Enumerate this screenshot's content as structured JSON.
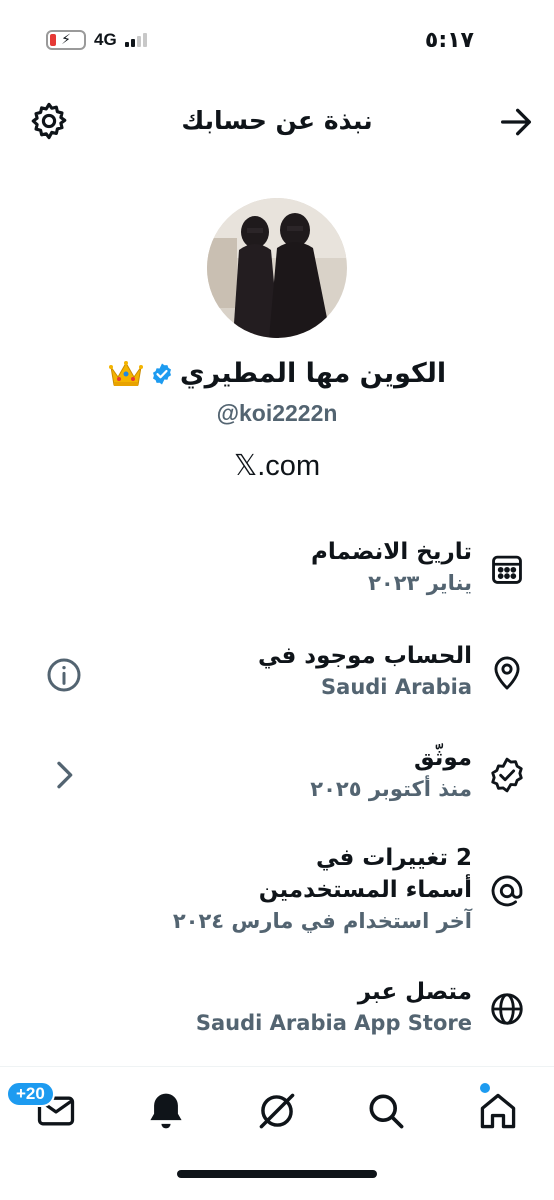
{
  "status_bar": {
    "time": "٥:١٧",
    "network": "4G"
  },
  "header": {
    "title": "نبذة عن حسابك"
  },
  "profile": {
    "name": "الكوين مها المطيري",
    "handle": "@koi2222n",
    "website": "𝕏.com"
  },
  "info": [
    {
      "icon": "calendar-icon",
      "title": "تاريخ الانضمام",
      "sub": "يناير ٢٠٢٣"
    },
    {
      "icon": "location-icon",
      "title": "الحساب موجود في",
      "sub": "Saudi Arabia"
    },
    {
      "icon": "verified-badge-icon",
      "title": "موثّق",
      "sub": "منذ أكتوبر ٢٠٢٥"
    },
    {
      "icon": "at-icon",
      "title_line1": "2 تغييرات في",
      "title_line2": "أسماء المستخدمين",
      "sub": "آخر استخدام في مارس ٢٠٢٤"
    },
    {
      "icon": "globe-icon",
      "title": "متصل عبر",
      "sub": "Saudi Arabia App Store"
    }
  ],
  "tabbar": {
    "messages_badge": "+20"
  },
  "colors": {
    "accent": "#1d9bf0",
    "secondary_text": "#536471",
    "primary_text": "#0f1419"
  }
}
